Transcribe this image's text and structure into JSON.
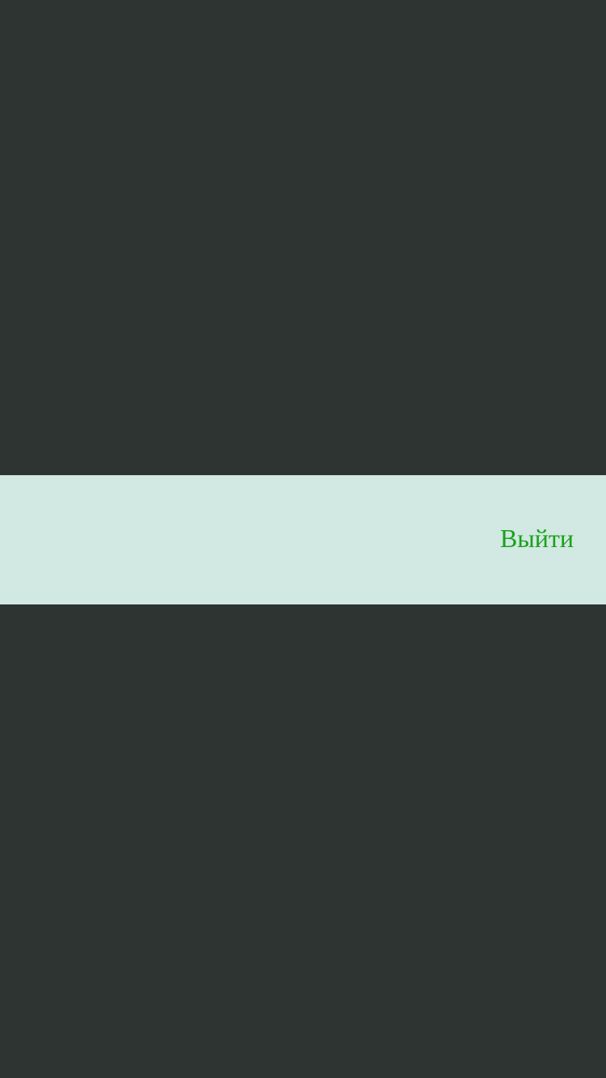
{
  "overlay": {
    "background_color": "#2d3432"
  },
  "action_sheet": {
    "background_color": "#d2e8e2",
    "logout_label": "Выйти",
    "logout_color": "#1aa11c"
  }
}
